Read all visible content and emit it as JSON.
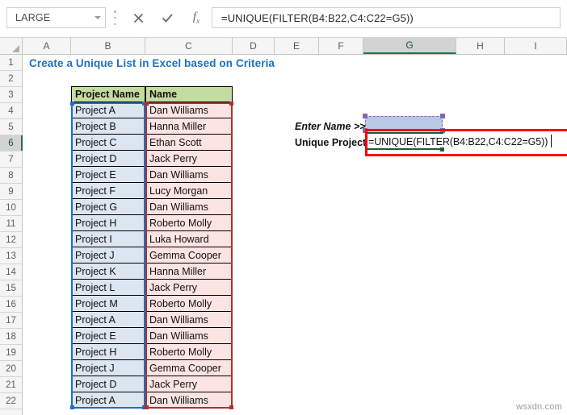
{
  "formula_bar": {
    "name_box_value": "LARGE",
    "name_box_dropdown_icon": "chevron-down-icon",
    "cancel_icon": "cancel-x-icon",
    "confirm_icon": "confirm-check-icon",
    "function_icon": "insert-function-fx-icon",
    "formula_value": "=UNIQUE(FILTER(B4:B22,C4:C22=G5))"
  },
  "grid": {
    "select_all_icon": "select-all-corner-icon",
    "columns": [
      "A",
      "B",
      "C",
      "D",
      "E",
      "F",
      "G",
      "H",
      "I"
    ],
    "selected_column": "G",
    "rows": [
      "1",
      "2",
      "3",
      "4",
      "5",
      "6",
      "7",
      "8",
      "9",
      "10",
      "11",
      "12",
      "13",
      "14",
      "15",
      "16",
      "17",
      "18",
      "19",
      "20",
      "21",
      "22"
    ],
    "selected_row": "6"
  },
  "sheet": {
    "title": "Create a Unique List in Excel based on Criteria",
    "table": {
      "headers": [
        "Project Name",
        "Name"
      ],
      "rows": [
        [
          "Project A",
          "Dan Williams"
        ],
        [
          "Project B",
          "Hanna Miller"
        ],
        [
          "Project C",
          "Ethan Scott"
        ],
        [
          "Project D",
          "Jack Perry"
        ],
        [
          "Project E",
          "Dan Williams"
        ],
        [
          "Project F",
          "Lucy Morgan"
        ],
        [
          "Project G",
          "Dan Williams"
        ],
        [
          "Project H",
          "Roberto Molly"
        ],
        [
          "Project I",
          "Luka Howard"
        ],
        [
          "Project J",
          "Gemma Cooper"
        ],
        [
          "Project K",
          "Hanna Miller"
        ],
        [
          "Project L",
          "Jack Perry"
        ],
        [
          "Project M",
          "Roberto Molly"
        ],
        [
          "Project A",
          "Dan Williams"
        ],
        [
          "Project E",
          "Dan Williams"
        ],
        [
          "Project H",
          "Roberto Molly"
        ],
        [
          "Project J",
          "Gemma Cooper"
        ],
        [
          "Project D",
          "Jack Perry"
        ],
        [
          "Project A",
          "Dan Williams"
        ]
      ]
    },
    "labels": {
      "enter_name": "Enter Name >>>",
      "unique_project_list": "Unique Project List"
    },
    "cell_g5_value": "",
    "cell_g6_formula": {
      "part1": "=UNIQUE(FILTER(",
      "ref_b": "B4:B22",
      "comma": ",",
      "ref_c": "C4:C22",
      "equals": "=",
      "ref_g": "G5",
      "close_red": ")",
      "close_blue": ")"
    }
  },
  "colors": {
    "title_blue": "#1f6fc4",
    "header_green": "#c5dca0",
    "range_blue": "#1f6fc4",
    "range_red": "#b03030",
    "marching_purple": "#8a64b0",
    "annotation_red": "#ff0000",
    "tab_green": "#207245"
  },
  "watermark": "wsxdn.com"
}
